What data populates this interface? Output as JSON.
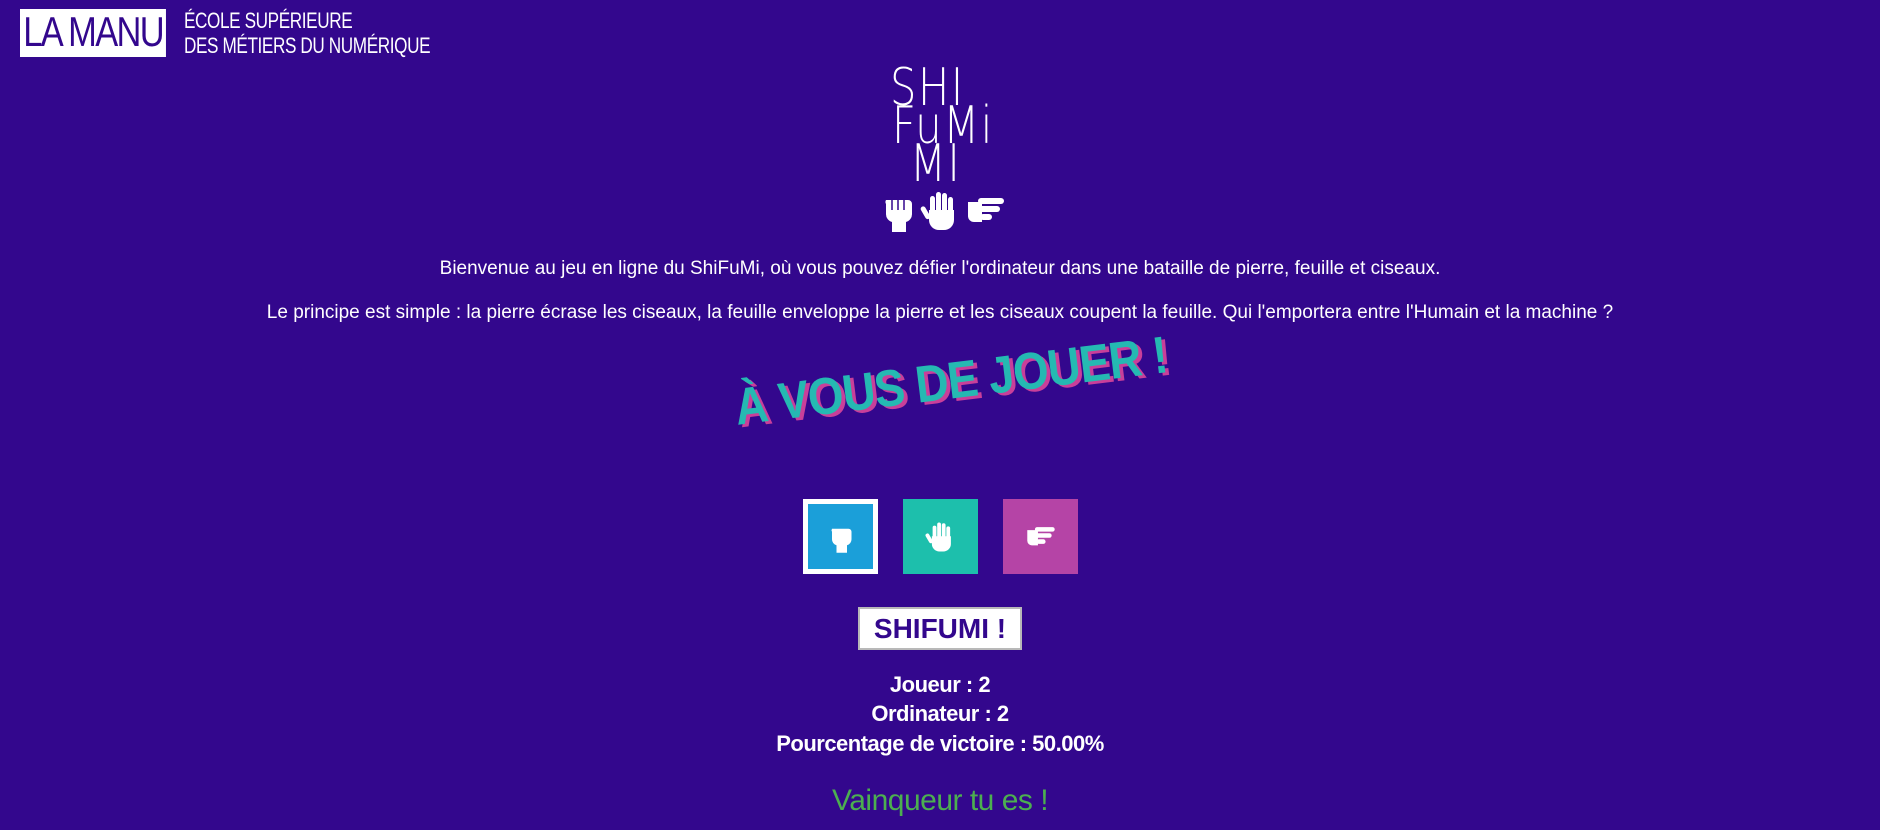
{
  "header": {
    "brand_main": "LA MANU",
    "brand_line1": "ÉCOLE SUPÉRIEURE",
    "brand_line2": "DES MÉTIERS DU NUMÉRIQUE"
  },
  "logo": {
    "line1": "SHI",
    "line2": "FuMi",
    "line3": "MI",
    "hand_icons": [
      "fist-icon",
      "open-hand-icon",
      "scissors-hand-icon"
    ]
  },
  "intro": {
    "line1": "Bienvenue au jeu en ligne du ShiFuMi, où vous pouvez défier l'ordinateur dans une bataille de pierre, feuille et ciseaux.",
    "line2": "Le principe est simple : la pierre écrase les ciseaux, la feuille enveloppe la pierre et les ciseaux coupent la feuille. Qui l'emportera entre l'Humain et la machine ?"
  },
  "play_title": "À VOUS DE JOUER !",
  "choices": [
    {
      "name": "pierre",
      "icon": "fist-icon",
      "color": "#1b9fd9",
      "selected": true
    },
    {
      "name": "feuille",
      "icon": "open-hand-icon",
      "color": "#1dbfac",
      "selected": false
    },
    {
      "name": "ciseaux",
      "icon": "scissors-hand-icon",
      "color": "#b544a6",
      "selected": false
    }
  ],
  "play_button": "SHIFUMI !",
  "score": {
    "player": "Joueur : 2",
    "computer": "Ordinateur : 2",
    "win_rate": "Pourcentage de victoire : 50.00%"
  },
  "result": "Vainqueur tu es !",
  "colors": {
    "background": "#33078d",
    "title": "#25b9b2",
    "title_shadow": "#c93f9a",
    "result": "#4caf50"
  }
}
